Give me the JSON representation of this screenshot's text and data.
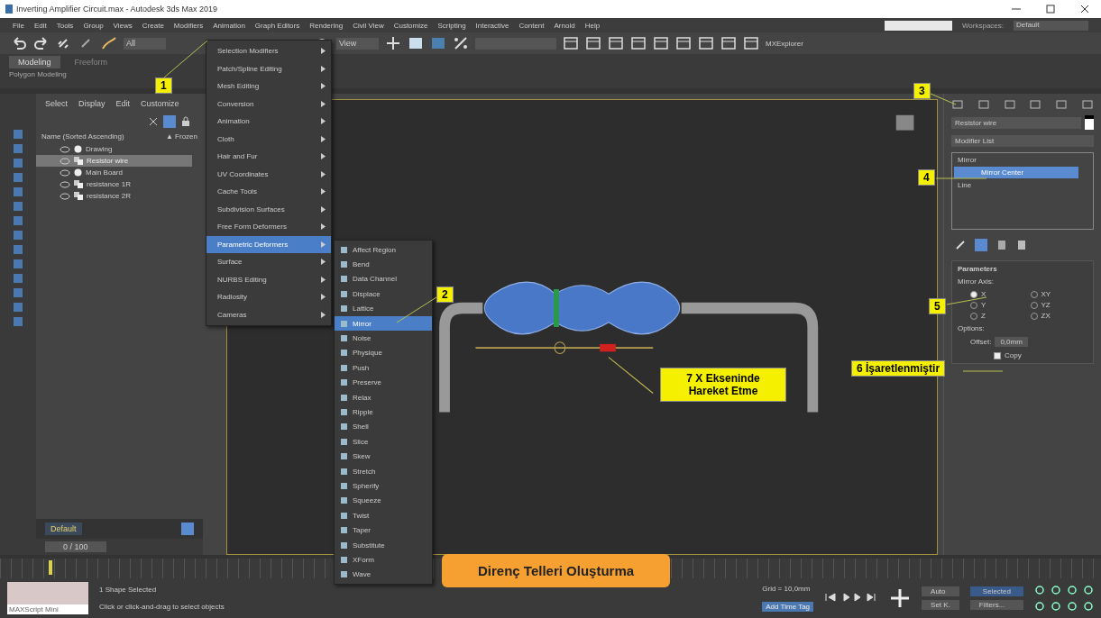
{
  "window": {
    "title": "Inverting Amplifier Circuit.max - Autodesk 3ds Max 2019"
  },
  "menu_bar": {
    "items": [
      "File",
      "Edit",
      "Tools",
      "Group",
      "Views",
      "Create",
      "Modifiers",
      "Animation",
      "Graph Editors",
      "Rendering",
      "Civil View",
      "Customize",
      "Scripting",
      "Interactive",
      "Content",
      "Arnold",
      "Help"
    ],
    "workspaces_label": "Workspaces:",
    "workspace": "Default"
  },
  "toolbar": {
    "selection_filter": "All",
    "view_dropdown": "View",
    "explorer_label": "MXExplorer"
  },
  "ribbon": {
    "tabs": [
      {
        "label": "Modeling",
        "selected": true
      },
      {
        "label": "Freeform",
        "selected": false
      }
    ],
    "panel_label": "Polygon Modeling"
  },
  "scene_explorer": {
    "tabs": [
      "Select",
      "Display",
      "Edit",
      "Customize"
    ],
    "column": "Name (Sorted Ascending)",
    "frozen_column": "▲ Frozen",
    "items": [
      {
        "name": "Drawing",
        "kind": "sphere",
        "selected": false
      },
      {
        "name": "Resistor wire",
        "kind": "shape",
        "selected": true
      },
      {
        "name": "Main Board",
        "kind": "sphere",
        "selected": false
      },
      {
        "name": "resistance 1R",
        "kind": "shape",
        "selected": false
      },
      {
        "name": "resistance 2R",
        "kind": "shape",
        "selected": false
      }
    ],
    "layer": "Default",
    "frame": "0 / 100"
  },
  "modifiers_menu": {
    "items": [
      {
        "label": "Selection Modifiers",
        "selected": false
      },
      {
        "label": "Patch/Spline Editing",
        "selected": false
      },
      {
        "label": "Mesh Editing",
        "selected": false
      },
      {
        "label": "Conversion",
        "selected": false
      },
      {
        "label": "Animation",
        "selected": false
      },
      {
        "label": "Cloth",
        "selected": false
      },
      {
        "label": "Hair and Fur",
        "selected": false
      },
      {
        "label": "UV Coordinates",
        "selected": false
      },
      {
        "label": "Cache Tools",
        "selected": false
      },
      {
        "label": "Subdivision Surfaces",
        "selected": false
      },
      {
        "label": "Free Form Deformers",
        "selected": false
      },
      {
        "label": "Parametric Deformers",
        "selected": true
      },
      {
        "label": "Surface",
        "selected": false
      },
      {
        "label": "NURBS Editing",
        "selected": false
      },
      {
        "label": "Radiosity",
        "selected": false
      },
      {
        "label": "Cameras",
        "selected": false
      }
    ]
  },
  "parametric_submenu": {
    "items": [
      {
        "label": "Affect Region",
        "selected": false
      },
      {
        "label": "Bend",
        "selected": false
      },
      {
        "label": "Data Channel",
        "selected": false
      },
      {
        "label": "Displace",
        "selected": false
      },
      {
        "label": "Lattice",
        "selected": false
      },
      {
        "label": "Mirror",
        "selected": true
      },
      {
        "label": "Noise",
        "selected": false
      },
      {
        "label": "Physique",
        "selected": false
      },
      {
        "label": "Push",
        "selected": false
      },
      {
        "label": "Preserve",
        "selected": false
      },
      {
        "label": "Relax",
        "selected": false
      },
      {
        "label": "Ripple",
        "selected": false
      },
      {
        "label": "Shell",
        "selected": false
      },
      {
        "label": "Slice",
        "selected": false
      },
      {
        "label": "Skew",
        "selected": false
      },
      {
        "label": "Stretch",
        "selected": false
      },
      {
        "label": "Spherify",
        "selected": false
      },
      {
        "label": "Squeeze",
        "selected": false
      },
      {
        "label": "Twist",
        "selected": false
      },
      {
        "label": "Taper",
        "selected": false
      },
      {
        "label": "Substitute",
        "selected": false
      },
      {
        "label": "XForm",
        "selected": false
      },
      {
        "label": "Wave",
        "selected": false
      }
    ]
  },
  "command_panel": {
    "object_name": "Resistor wire",
    "modifier_list": "Modifier List",
    "stack": [
      {
        "label": "Mirror",
        "selected": false,
        "children": [
          {
            "label": "Mirror Center",
            "selected": true
          }
        ]
      },
      {
        "label": "Line",
        "selected": false
      }
    ],
    "rollout": "Parameters",
    "mirror_axis_label": "Mirror Axis:",
    "axes": [
      {
        "label": "X",
        "selected": true
      },
      {
        "label": "XY",
        "selected": false
      },
      {
        "label": "Y",
        "selected": false
      },
      {
        "label": "YZ",
        "selected": false
      },
      {
        "label": "Z",
        "selected": false
      },
      {
        "label": "ZX",
        "selected": false
      }
    ],
    "options_label": "Options:",
    "offset_label": "Offset:",
    "offset_value": "0,0mm",
    "copy": {
      "label": "Copy",
      "checked": true
    }
  },
  "callouts": [
    {
      "kind": "marker",
      "text": "1"
    },
    {
      "kind": "marker",
      "text": "2"
    },
    {
      "kind": "marker",
      "text": "3"
    },
    {
      "kind": "marker",
      "text": "4"
    },
    {
      "kind": "marker",
      "text": "5"
    },
    {
      "kind": "marker",
      "text": "6 İşaretlenmiştir"
    },
    {
      "kind": "note",
      "text": "7 X Ekseninde Hareket Etme"
    },
    {
      "kind": "banner",
      "text": "Direnç Telleri Oluşturma"
    }
  ],
  "status_bar": {
    "maxscript": "MAXScript Mini",
    "selection": "1 Shape Selected",
    "prompt": "Click or click-and-drag to select objects",
    "grid": "Grid = 10,0mm",
    "time_tag": "Add Time Tag",
    "auto": "Auto",
    "key_filter": "Selected",
    "set_key": "Set K.",
    "filters": "Filters..."
  }
}
